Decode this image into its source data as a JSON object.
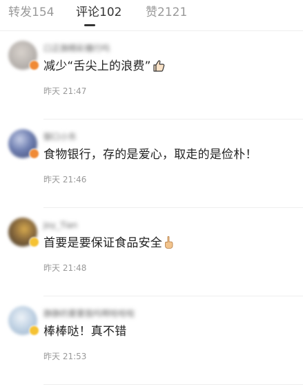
{
  "tabs": {
    "reposts": "转发154",
    "comments": "评论102",
    "likes": "赞2121"
  },
  "comments": [
    {
      "username": "口正旗精彩播行吗",
      "text": "减少“舌尖上的浪费”",
      "emoji": "thumbs-up-outline-icon",
      "time": "昨天 21:47",
      "avatar_color": "#b9b4b0",
      "badge_color": "#f08a36"
    },
    {
      "username": "御口小东",
      "text": "食物银行，存的是爱心，取走的是俭朴！",
      "emoji": "",
      "time": "昨天 21:46",
      "avatar_color": "#5d6c9a",
      "badge_color": "#f08a36"
    },
    {
      "username": "Joy_Tian",
      "text": "首要是要保证食品安全",
      "emoji": "pointing-up-hand-icon",
      "time": "昨天 21:48",
      "avatar_color": "#6b5b45",
      "badge_color": "#f5c233"
    },
    {
      "username": "静静的要要我吗啊哈哈啦",
      "text": "棒棒哒！真不错",
      "emoji": "",
      "time": "昨天 21:53",
      "avatar_color": "#a9c0d8",
      "badge_color": "#f5c233"
    }
  ]
}
